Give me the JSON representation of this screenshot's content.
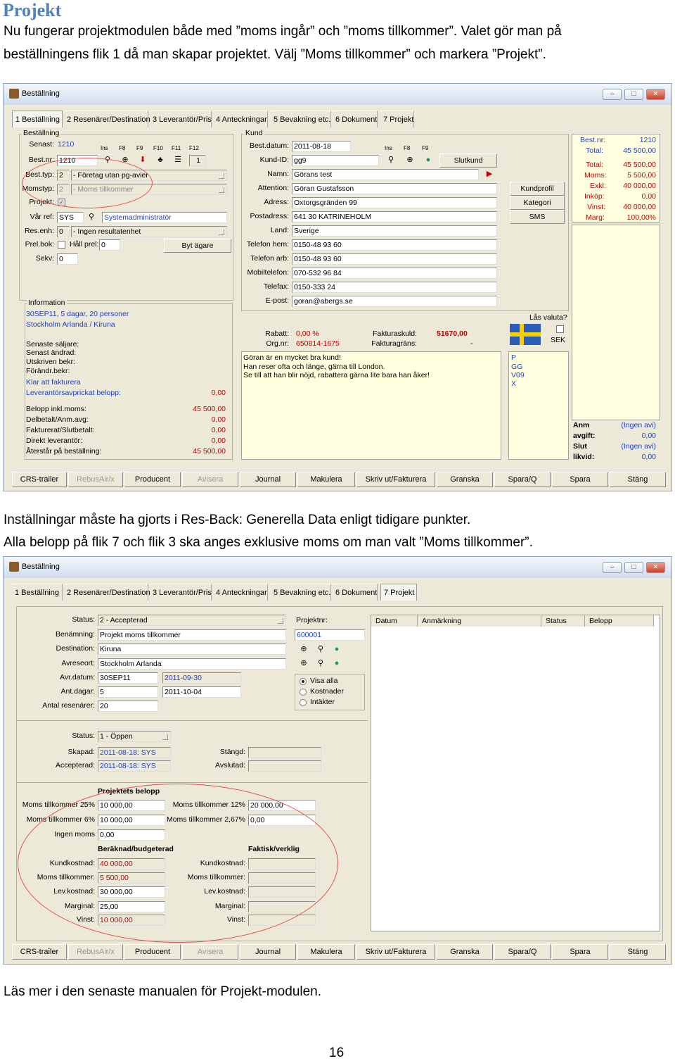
{
  "doc": {
    "heading": "Projekt",
    "intro_line1": "Nu fungerar projektmodulen både med ”moms ingår” och ”moms tillkommer”. Valet gör man på",
    "intro_line2": "beställningens flik 1 då man skapar projektet. Välj ”Moms tillkommer” och markera ”Projekt”.",
    "mid_line1": "Inställningar måste ha gjorts i Res-Back: Generella Data enligt tidigare punkter.",
    "mid_line2": "Alla belopp på flik 7 och flik 3 ska anges exklusive moms om man valt ”Moms tillkommer”.",
    "outro": "Läs mer i den senaste manualen för Projekt-modulen.",
    "page_number": "16"
  },
  "window_title": "Beställning",
  "window_buttons": [
    "–",
    "□",
    "×"
  ],
  "tabs": [
    "1 Beställning",
    "2 Resenärer/Destination",
    "3 Leverantör/Pris",
    "4 Anteckningar",
    "5 Bevakning etc.",
    "6 Dokument",
    "7 Projekt"
  ],
  "bottom_buttons": [
    "CRS-trailer",
    "RebusAir/x",
    "Producent",
    "Avisera",
    "Journal",
    "Makulera",
    "Skriv ut/Fakturera",
    "Granska",
    "Spara/Q",
    "Spara",
    "Stäng"
  ],
  "s1": {
    "bestallning_group": "Beställning",
    "senast_label": "Senast:",
    "senast_value": "1210",
    "fkeys": [
      "Ins",
      "F8",
      "F9",
      "F10",
      "F11",
      "F12"
    ],
    "bestnr_label": "Best.nr:",
    "bestnr_value": "1210",
    "bestnr_count": "1",
    "besttyp_label": "Best.typ:",
    "besttyp_code": "2",
    "besttyp_value": "- Företag utan pg-avier",
    "momstyp_label": "Momstyp:",
    "momstyp_code": "2",
    "momstyp_value": "- Moms tillkommer",
    "projekt_label": "Projekt:",
    "varref_label": "Vår ref:",
    "varref_code": "SYS",
    "varref_value": "Systemadministratör",
    "resenh_label": "Res.enh:",
    "resenh_code": "0",
    "resenh_value": "- Ingen resultatenhet",
    "prelbok_label": "Prel.bok:",
    "hallprel_label": "Håll prel:",
    "hallprel_value": "0",
    "bytagare": "Byt ägare",
    "sekv_label": "Sekv:",
    "sekv_value": "0",
    "kund_group": "Kund",
    "bestdatum_label": "Best.datum:",
    "bestdatum_value": "2011-08-18",
    "kund_fkeys": [
      "Ins",
      "F8",
      "F9"
    ],
    "kundid_label": "Kund-ID:",
    "kundid_value": "gg9",
    "slutkund": "Slutkund",
    "namn_label": "Namn:",
    "namn_value": "Görans test",
    "attention_label": "Attention:",
    "attention_value": "Göran Gustafsson",
    "adress_label": "Adress:",
    "adress_value": "Oxtorgsgränden 99",
    "postadress_label": "Postadress:",
    "postadress_value": "641 30 KATRINEHOLM",
    "land_label": "Land:",
    "land_value": "Sverige",
    "telhem_label": "Telefon hem:",
    "telhem_value": "0150-48 93 60",
    "telarb_label": "Telefon arb:",
    "telarb_value": "0150-48 93 60",
    "mobil_label": "Mobiltelefon:",
    "mobil_value": "070-532 96 84",
    "telefax_label": "Telefax:",
    "telefax_value": "0150-333 24",
    "epost_label": "E-post:",
    "epost_value": "goran@abergs.se",
    "kundprofil": "Kundprofil",
    "kategori": "Kategori",
    "sms": "SMS",
    "summary": [
      {
        "label": "Best.nr:",
        "value": "1210"
      },
      {
        "label": "Total:",
        "value": "45 500,00"
      },
      {
        "label": "Total:",
        "value": "45 500,00"
      },
      {
        "label": "Moms:",
        "value": "5 500,00"
      },
      {
        "label": "Exkl:",
        "value": "40 000,00"
      },
      {
        "label": "Inköp:",
        "value": "0,00"
      },
      {
        "label": "Vinst:",
        "value": "40 000,00"
      },
      {
        "label": "Marg:",
        "value": "100,00%"
      }
    ],
    "info_group": "Information",
    "info_line1": "30SEP11, 5 dagar, 20 personer",
    "info_line2": "Stockholm Arlanda / Kiruna",
    "senast_saljare": "Senaste säljare:",
    "senast_andrad": "Senast ändrad:",
    "utskriven": "Utskriven bekr:",
    "forandr": "Förändr.bekr:",
    "klar": "Klar att fakturera",
    "levavprickat_label": "Leverantörsavprickat belopp:",
    "levavprickat_value": "0,00",
    "amounts": [
      {
        "label": "Belopp inkl.moms:",
        "value": "45 500,00"
      },
      {
        "label": "Delbetalt/Anm.avg:",
        "value": "0,00"
      },
      {
        "label": "Fakturerat/Slutbetalt:",
        "value": "0,00"
      },
      {
        "label": "Direkt leverantör:",
        "value": "0,00"
      },
      {
        "label": "Återstår på beställning:",
        "value": "45 500,00"
      }
    ],
    "lasvaluta": "Lås valuta?",
    "sek": "SEK",
    "rabatt_label": "Rabatt:",
    "rabatt_value": "0,00 %",
    "orgnr_label": "Org.nr:",
    "orgnr_value": "650814-1675",
    "fakturaskuld_label": "Fakturaskuld:",
    "fakturaskuld_value": "51670,00",
    "fakturagrans_label": "Fakturagräns:",
    "fakturagrans_value": "-",
    "notes": [
      "Göran är en mycket bra kund!",
      "Han reser ofta och länge, gärna till London.",
      "Se till att han blir nöjd, rabattera gärna lite bara han åker!"
    ],
    "codes": [
      "P",
      "GG",
      "V09",
      "X"
    ],
    "bottom_summary": [
      {
        "label": "Anm",
        "value": "(Ingen avi)"
      },
      {
        "label": "avgift:",
        "value": "0,00"
      },
      {
        "label": "Slut",
        "value": "(Ingen avi)"
      },
      {
        "label": "likvid:",
        "value": "0,00"
      }
    ]
  },
  "s2": {
    "status_label": "Status:",
    "status_value": "2 - Accepterad",
    "benamning_label": "Benämning:",
    "benamning_value": "Projekt moms tillkommer",
    "destination_label": "Destination:",
    "destination_value": "Kiruna",
    "avreseort_label": "Avreseort:",
    "avreseort_value": "Stockholm Arlanda",
    "avrdatum_label": "Avr.datum:",
    "avrdatum_value": "30SEP11",
    "avrdatum_date": "2011-09-30",
    "antdagar_label": "Ant.dagar:",
    "antdagar_value": "5",
    "antdagar_date": "2011-10-04",
    "antres_label": "Antal resenärer:",
    "antres_value": "20",
    "projektnr_label": "Projektnr:",
    "projektnr_value": "600001",
    "radio_visa": "Visa alla",
    "radio_kost": "Kostnader",
    "radio_intakter": "Intäkter",
    "table_headers": [
      "Datum",
      "Anmärkning",
      "Status",
      "Belopp"
    ],
    "pstatus_label": "Status:",
    "pstatus_value": "1 - Öppen",
    "skapad_label": "Skapad:",
    "skapad_value": "2011-08-18: SYS",
    "accepterad_label": "Accepterad:",
    "accepterad_value": "2011-08-18: SYS",
    "stangd_label": "Stängd:",
    "avslutad_label": "Avslutad:",
    "projektets_belopp": "Projektets belopp",
    "mt25_label": "Moms tillkommer 25%",
    "mt25_value": "10 000,00",
    "mt6_label": "Moms tillkommer 6%",
    "mt6_value": "10 000,00",
    "ingen_label": "Ingen moms",
    "ingen_value": "0,00",
    "mt12_label": "Moms tillkommer 12%",
    "mt12_value": "20 000,00",
    "mt267_label": "Moms tillkommer 2,67%",
    "mt267_value": "0,00",
    "beraknad_header": "Beräknad/budgeterad",
    "faktisk_header": "Faktisk/verklig",
    "kundkostnad_label": "Kundkostnad:",
    "kundkostnad_value": "40 000,00",
    "momstillk_label": "Moms tillkommer:",
    "momstillk_value": "5 500,00",
    "levkostnad_label": "Lev.kostnad:",
    "levkostnad_value": "30 000,00",
    "marginal_label": "Marginal:",
    "marginal_value": "25,00",
    "vinst_label": "Vinst:",
    "vinst_value": "10 000,00"
  }
}
